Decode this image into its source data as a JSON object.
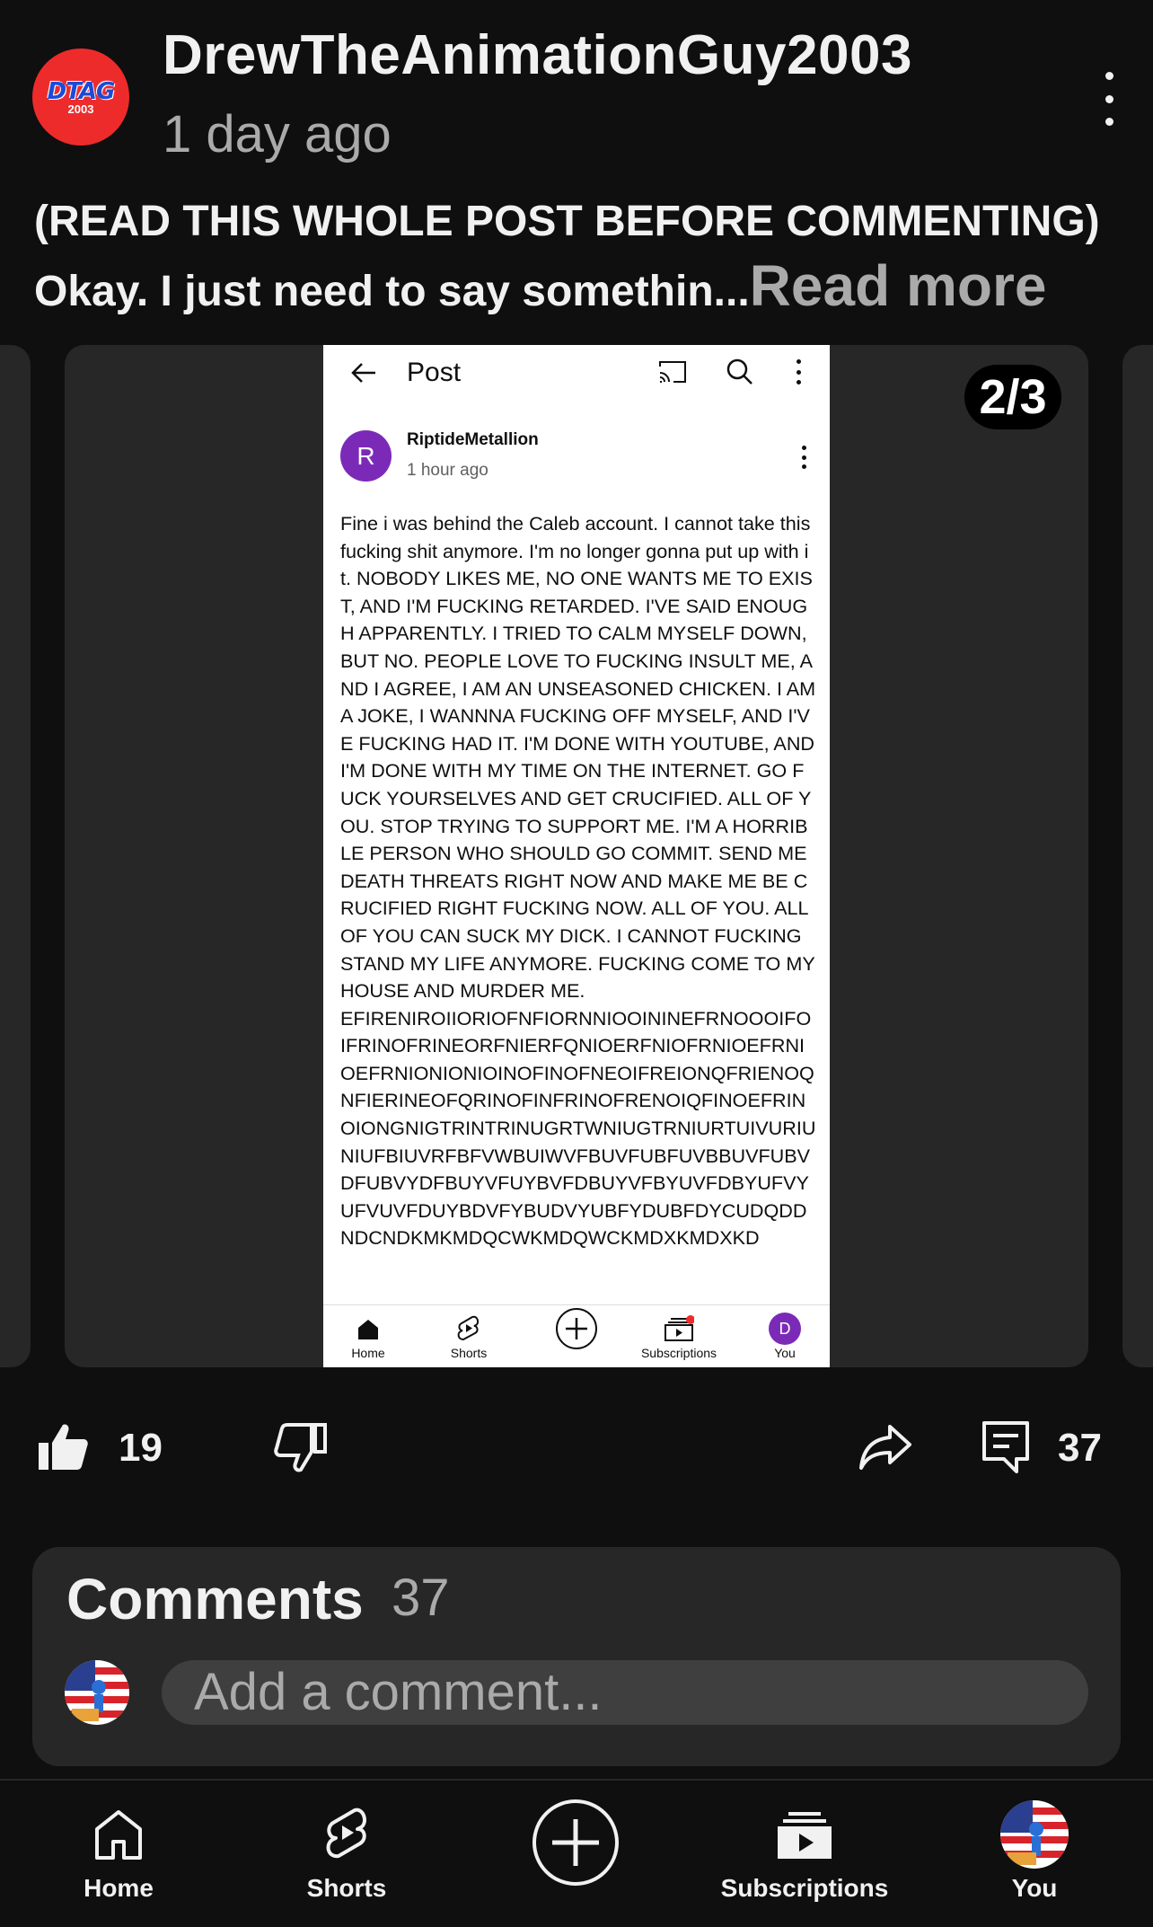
{
  "post": {
    "channel_name": "DrewTheAnimationGuy2003",
    "channel_avatar_text": "DTAG",
    "channel_avatar_subtext": "2003",
    "time": "1 day ago",
    "line1": "(READ THIS WHOLE POST BEFORE COMMENTING)",
    "line2": "Okay. I just need to say somethin...",
    "read_more": "Read more"
  },
  "carousel": {
    "indicator": "2/3"
  },
  "screenshot": {
    "title": "Post",
    "author": "RiptideMetallion",
    "author_initial": "R",
    "time": "1 hour ago",
    "text": "Fine i was behind the Caleb account. I cannot take this fucking shit anymore. I'm no longer gonna put up with it. NOBODY LIKES ME, NO ONE WANTS ME TO EXIST, AND I'M FUCKING RETARDED. I'VE SAID ENOUGH APPARENTLY. I TRIED TO CALM MYSELF DOWN, BUT NO. PEOPLE LOVE TO FUCKING INSULT ME, AND I AGREE, I AM AN UNSEASONED CHICKEN. I AM A JOKE, I WANNNA FUCKING OFF MYSELF, AND I'VE FUCKING HAD IT. I'M DONE WITH YOUTUBE, AND I'M DONE WITH MY TIME ON THE INTERNET. GO FUCK YOURSELVES AND GET CRUCIFIED. ALL OF YOU. STOP TRYING TO SUPPORT ME. I'M A HORRIBLE PERSON WHO SHOULD GO COMMIT. SEND ME DEATH THREATS RIGHT NOW AND MAKE ME BE CRUCIFIED RIGHT FUCKING NOW. ALL OF YOU. ALL OF YOU CAN SUCK MY DICK. I CANNOT FUCKING STAND MY LIFE ANYMORE. FUCKING COME TO MY HOUSE AND MURDER ME.\nEFIRENIROIIORIOFNFIORNNIOOININEFRNOOOIFOIFRINOFRINEORFNIERFQNIOERFNIOFRNIOEFRNIOEFRNIONIONIOINOFINOFNEOIFREIONQFRIENOQNFIERINEOFQRINOFINFRINOFRENOIQFINOEFRINOIONGNIGTRINTRINUGRTWNIUGTRNIURTUIVURIUNIUFBIUVRFBFVWBUIWVFBUVFUBFUVBBUVFUBVDFUBVYDFBUYVFUYBVFDBUYVFBYUVFDBYUFVYUFVUVFDUYBDVFYBUDVYUBFYDUBFDYCUDQDDNDCNDKMKMDQCWKMDQWCKMDXKMDXKD",
    "nav": {
      "home": "Home",
      "shorts": "Shorts",
      "subscriptions": "Subscriptions",
      "you": "You",
      "you_initial": "D"
    }
  },
  "actions": {
    "likes": "19",
    "comments": "37"
  },
  "comments": {
    "title": "Comments",
    "count": "37",
    "placeholder": "Add a comment..."
  },
  "bottom_nav": {
    "home": "Home",
    "shorts": "Shorts",
    "subscriptions": "Subscriptions",
    "you": "You"
  },
  "colors": {
    "background": "#0f0f0f",
    "card": "#272727",
    "channel_avatar": "#ee2b2b",
    "screenshot_avatar": "#7b2ab8",
    "muted_text": "#aaaaaa"
  }
}
